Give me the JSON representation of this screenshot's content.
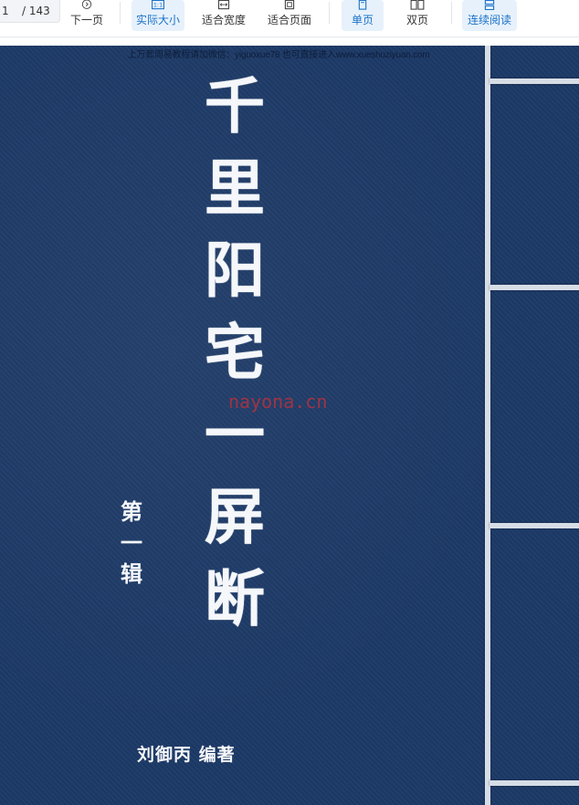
{
  "toolbar": {
    "page_current": "1",
    "page_total": "/ 143",
    "buttons": [
      {
        "label": "下一页",
        "icon": "next-page-icon"
      },
      {
        "label": "实际大小",
        "icon": "actual-size-icon"
      },
      {
        "label": "适合宽度",
        "icon": "fit-width-icon"
      },
      {
        "label": "适合页面",
        "icon": "fit-page-icon"
      },
      {
        "label": "单页",
        "icon": "single-page-icon"
      },
      {
        "label": "双页",
        "icon": "two-page-icon"
      },
      {
        "label": "连续阅读",
        "icon": "continuous-read-icon"
      }
    ],
    "active_colors": {
      "bg": "#e7f1fb",
      "fg": "#1a73c8"
    }
  },
  "cover": {
    "background": "#1c3966",
    "watermark_top": "上万套周易教程请加微信：yiguoxue78  也可直接进入www.xueshuziyuan.com",
    "title_chars": [
      "千",
      "里",
      "阳",
      "宅",
      "一",
      "屏",
      "断"
    ],
    "volume_chars": [
      "第",
      "一",
      "辑"
    ],
    "author": "刘御丙  编著",
    "watermark_mid": "nayona.cn"
  }
}
